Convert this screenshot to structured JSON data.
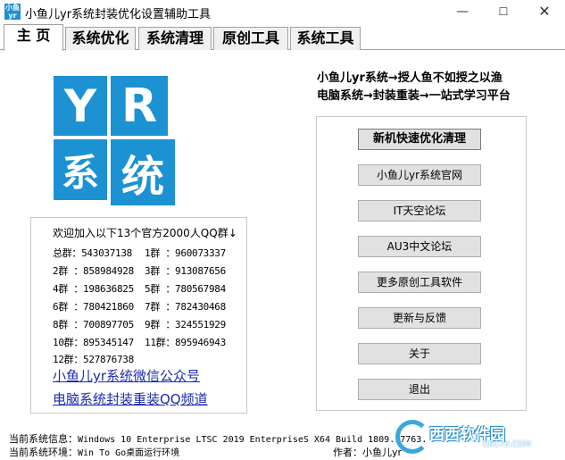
{
  "window": {
    "icon_text": "小鱼\nyr",
    "title": "小鱼儿yr系统封装优化设置辅助工具",
    "min_glyph": "—",
    "max_glyph": "☐",
    "close_glyph": "✕"
  },
  "tabs": [
    "主 页",
    "系统优化",
    "系统清理",
    "原创工具",
    "系统工具"
  ],
  "logo": {
    "tile1": "Y",
    "tile2": "R",
    "tile3": "系",
    "tile4": "统"
  },
  "qq": {
    "title": "欢迎加入以下13个官方2000人QQ群↓",
    "rows": [
      [
        "总群：543037138",
        "1群 ：960073337"
      ],
      [
        "2群 ：858984928",
        "3群 ：913087656"
      ],
      [
        "4群 ：198636825",
        "5群 ：780567984"
      ],
      [
        "6群 ：780421860",
        "7群 ：782430468"
      ],
      [
        "8群 ：700897705",
        "9群 ：324551929"
      ],
      [
        "10群：895345147",
        "11群：895946943"
      ],
      [
        "12群：527876738",
        ""
      ]
    ]
  },
  "links": {
    "wechat": "小鱼儿yr系统微信公众号",
    "qq_channel": "电脑系统封装重装QQ频道"
  },
  "slogans": {
    "line1": "小鱼儿yr系统→授人鱼不如授之以渔",
    "line2": "电脑系统→封装重装→一站式学习平台"
  },
  "buttons": {
    "quick_clean": "新机快速优化清理",
    "official_site": "小鱼儿yr系统官网",
    "it_forum": "IT天空论坛",
    "au3_forum": "AU3中文论坛",
    "more_tools": "更多原创工具软件",
    "update_feedback": "更新与反馈",
    "about": "关于",
    "exit": "退出"
  },
  "status": {
    "sys_info_label": "当前系统信息：",
    "sys_info_value": "Windows 10 Enterprise LTSC 2019 EnterpriseS X64 Build 1809.17763.",
    "env_label": "当前系统环境：",
    "env_value": "Win To Go桌面运行环境",
    "author": "作者：小鱼儿yr"
  },
  "watermark": {
    "text": "西西软件园",
    "sub": "CR173.COM"
  },
  "colors": {
    "logo_blue": "#1c92d2",
    "link_blue": "#1a2bb0"
  }
}
